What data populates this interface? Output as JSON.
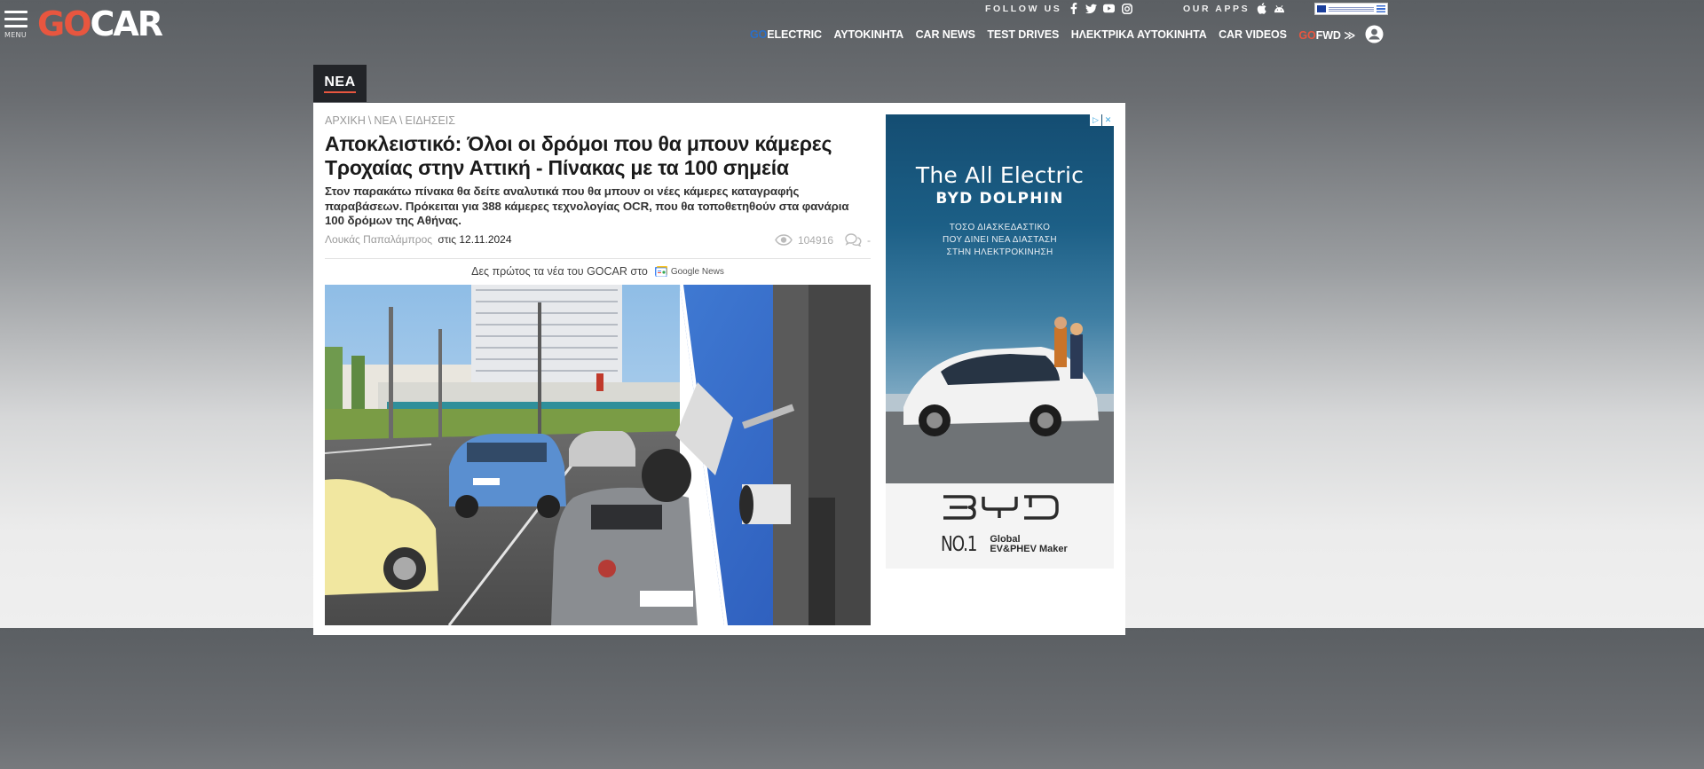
{
  "header": {
    "menu_label": "MENU",
    "logo_go": "GO",
    "logo_car": "CAR",
    "follow_label": "FOLLOW US",
    "apps_label": "OUR APPS",
    "social_icons": [
      "facebook-icon",
      "twitter-icon",
      "youtube-icon",
      "instagram-icon"
    ],
    "app_icons": [
      "apple-icon",
      "android-icon"
    ],
    "nav": [
      {
        "prefix": "GO",
        "label": "ELECTRIC"
      },
      {
        "prefix": "",
        "label": "ΑΥΤΟΚΙΝΗΤΑ"
      },
      {
        "prefix": "",
        "label": "CAR NEWS"
      },
      {
        "prefix": "",
        "label": "TEST DRIVES"
      },
      {
        "prefix": "",
        "label": "ΗΛΕΚΤΡΙΚΑ ΑΥΤΟΚΙΝΗΤΑ"
      },
      {
        "prefix": "",
        "label": "CAR VIDEOS"
      },
      {
        "prefix": "GO",
        "label": "FWD ≫"
      }
    ]
  },
  "category": "ΝΕΑ",
  "article": {
    "breadcrumb": [
      "ΑΡΧΙΚΗ",
      "ΝΕΑ",
      "ΕΙΔΗΣΕΙΣ"
    ],
    "breadcrumb_sep": "\\",
    "title": "Αποκλειστικό: Όλοι οι δρόμοι που θα μπουν κάμερες Τροχαίας στην Αττική - Πίνακας με τα 100 σημεία",
    "lead": "Στον παρακάτω πίνακα θα δείτε αναλυτικά που θα μπουν οι νέες κάμερες καταγραφής παραβάσεων. Πρόκειται για 388 κάμερες τεχνολογίας OCR, που θα τοποθετηθούν στα φανάρια 100 δρόμων της Αθήνας.",
    "author": "Λουκάς Παπαλάμπρος",
    "date_prefix": "στις",
    "date": "12.11.2024",
    "views": "104916",
    "comments": "-",
    "google_news_text": "Δες πρώτος τα νέα του GOCAR στο",
    "google_news_badge": "Google News"
  },
  "ad": {
    "headline": "The All Electric",
    "model": "BYD DOLPHIN",
    "tagline": [
      "ΤΟΣΟ ΔΙΑΣΚΕΔΑΣΤΙΚΟ",
      "ΠΟΥ ΔΙΝΕΙ ΝΕΑ ΔΙΑΣΤΑΣΗ",
      "ΣΤΗΝ ΗΛΕΚΤΡΟΚΙΝΗΣΗ"
    ],
    "no1": "NO.1",
    "slogan_line1": "Global",
    "slogan_line2": "EV&PHEV Maker"
  },
  "colors": {
    "brand_orange": "#e8563f",
    "electric_blue": "#2a6fc9",
    "tag_bg": "#222428",
    "ad_blue": "#144d72"
  }
}
